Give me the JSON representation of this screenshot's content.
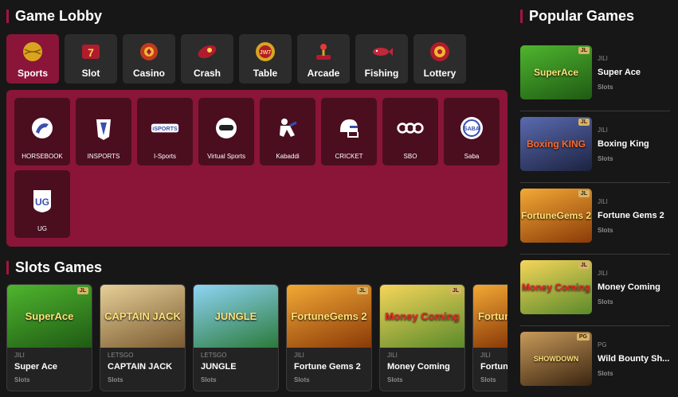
{
  "lobby": {
    "title": "Game Lobby",
    "tabs": [
      {
        "label": "Sports",
        "icon": "sports-ball-icon",
        "active": true
      },
      {
        "label": "Slot",
        "icon": "slot-seven-icon"
      },
      {
        "label": "Casino",
        "icon": "casino-chip-icon"
      },
      {
        "label": "Crash",
        "icon": "crash-rocket-icon"
      },
      {
        "label": "Table",
        "icon": "table-chip-icon"
      },
      {
        "label": "Arcade",
        "icon": "arcade-joystick-icon"
      },
      {
        "label": "Fishing",
        "icon": "fishing-fish-icon"
      },
      {
        "label": "Lottery",
        "icon": "lottery-ball-icon"
      }
    ],
    "providers": [
      {
        "label": "HORSEBOOK",
        "icon": "horsebook-logo-icon"
      },
      {
        "label": "INSPORTS",
        "icon": "insports-logo-icon"
      },
      {
        "label": "I-Sports",
        "icon": "isports-logo-icon"
      },
      {
        "label": "Virtual Sports",
        "icon": "virtual-sports-logo-icon"
      },
      {
        "label": "Kabaddi",
        "icon": "kabaddi-logo-icon"
      },
      {
        "label": "CRICKET",
        "icon": "cricket-helmet-icon"
      },
      {
        "label": "SBO",
        "icon": "sbo-logo-icon"
      },
      {
        "label": "Saba",
        "icon": "saba-logo-icon"
      },
      {
        "label": "UG",
        "icon": "ug-logo-icon"
      }
    ]
  },
  "slots": {
    "title": "Slots Games",
    "games": [
      {
        "provider": "JILI",
        "name": "Super Ace",
        "category": "Slots",
        "art": "SuperAce",
        "tag": "JL",
        "bg": "#2f7d1f"
      },
      {
        "provider": "LETSGO",
        "name": "CAPTAIN JACK",
        "category": "Slots",
        "art": "CAPTAIN JACK",
        "tag": "",
        "bg": "#b08a56"
      },
      {
        "provider": "LETSGO",
        "name": "JUNGLE",
        "category": "Slots",
        "art": "JUNGLE",
        "tag": "",
        "bg": "#3a8fc4"
      },
      {
        "provider": "JILI",
        "name": "Fortune Gems 2",
        "category": "Slots",
        "art": "FortuneGems 2",
        "tag": "JL",
        "bg": "#b8620f"
      },
      {
        "provider": "JILI",
        "name": "Money Coming",
        "category": "Slots",
        "art": "Money Coming",
        "tag": "JL",
        "bg": "#c89a2a"
      },
      {
        "provider": "JILI",
        "name": "Fortune Gems",
        "category": "Slots",
        "art": "Fortune",
        "tag": "JL",
        "bg": "#b8620f"
      }
    ]
  },
  "popular": {
    "title": "Popular Games",
    "games": [
      {
        "provider": "JILI",
        "name": "Super Ace",
        "category": "Slots",
        "art": "SuperAce",
        "tag": "JL",
        "bg": "#2f7d1f"
      },
      {
        "provider": "JILI",
        "name": "Boxing King",
        "category": "Slots",
        "art": "Boxing KING",
        "tag": "JL",
        "bg": "#3a4a78"
      },
      {
        "provider": "JILI",
        "name": "Fortune Gems 2",
        "category": "Slots",
        "art": "FortuneGems 2",
        "tag": "JL",
        "bg": "#b8620f"
      },
      {
        "provider": "JILI",
        "name": "Money Coming",
        "category": "Slots",
        "art": "Money Coming",
        "tag": "JL",
        "bg": "#c89a2a"
      },
      {
        "provider": "PG",
        "name": "Wild Bounty Sh...",
        "category": "Slots",
        "art": "SHOWDOWN",
        "tag": "PG",
        "bg": "#6b4a2a"
      }
    ]
  },
  "colors": {
    "accent": "#8a1538",
    "panel": "#8a1538",
    "provider_tile": "#4a0e1f",
    "background": "#171717"
  }
}
